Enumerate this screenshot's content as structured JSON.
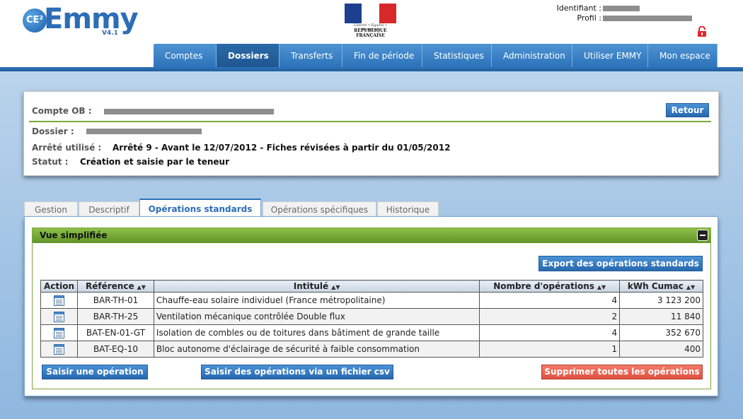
{
  "header": {
    "logo_badge": "CE²",
    "logo_text": "Emmy",
    "logo_version": "V4.1",
    "rf_motto": "Liberté • Égalité • Fraternité",
    "rf_name": "RÉPUBLIQUE FRANÇAISE",
    "identifiant_label": "Identifiant :",
    "profil_label": "Profil :",
    "lock_icon": "lock-icon",
    "colors": {
      "nav": "#2c72b8",
      "accent_green": "#7ba73a",
      "danger": "#e0513f"
    }
  },
  "nav": {
    "items": [
      {
        "label": "Comptes"
      },
      {
        "label": "Dossiers",
        "active": true
      },
      {
        "label": "Transferts"
      },
      {
        "label": "Fin de période"
      },
      {
        "label": "Statistiques"
      },
      {
        "label": "Administration"
      },
      {
        "label": "Utiliser EMMY"
      },
      {
        "label": "Mon espace"
      }
    ]
  },
  "info": {
    "compte_label": "Compte OB :",
    "dossier_label": "Dossier :",
    "arrete_label": "Arrêté utilisé :",
    "arrete_value": "Arrêté 9 - Avant le 12/07/2012 - Fiches révisées à partir du 01/05/2012",
    "statut_label": "Statut :",
    "statut_value": "Création et saisie par le teneur",
    "retour_label": "Retour"
  },
  "tabs": [
    {
      "label": "Gestion"
    },
    {
      "label": "Descriptif"
    },
    {
      "label": "Opérations standards",
      "active": true
    },
    {
      "label": "Opérations spécifiques"
    },
    {
      "label": "Historique"
    }
  ],
  "section": {
    "title": "Vue simplifiée",
    "export_label": "Export des opérations standards",
    "columns": [
      "Action",
      "Référence",
      "Intitulé",
      "Nombre d'opérations",
      "kWh Cumac"
    ],
    "rows": [
      {
        "ref": "BAR-TH-01",
        "intitule": "Chauffe-eau solaire individuel (France métropolitaine)",
        "nombre": "4",
        "kwh": "3 123 200"
      },
      {
        "ref": "BAR-TH-25",
        "intitule": "Ventilation mécanique contrôlée Double flux",
        "nombre": "2",
        "kwh": "11 840"
      },
      {
        "ref": "BAT-EN-01-GT",
        "intitule": "Isolation de combles ou de toitures dans bâtiment de grande taille",
        "nombre": "4",
        "kwh": "352 670"
      },
      {
        "ref": "BAT-EQ-10",
        "intitule": "Bloc autonome d'éclairage de sécurité à faible consommation",
        "nombre": "1",
        "kwh": "400"
      }
    ],
    "saisir_label": "Saisir une opération",
    "csv_label": "Saisir des opérations via un fichier csv",
    "supprimer_label": "Supprimer toutes les opérations"
  }
}
